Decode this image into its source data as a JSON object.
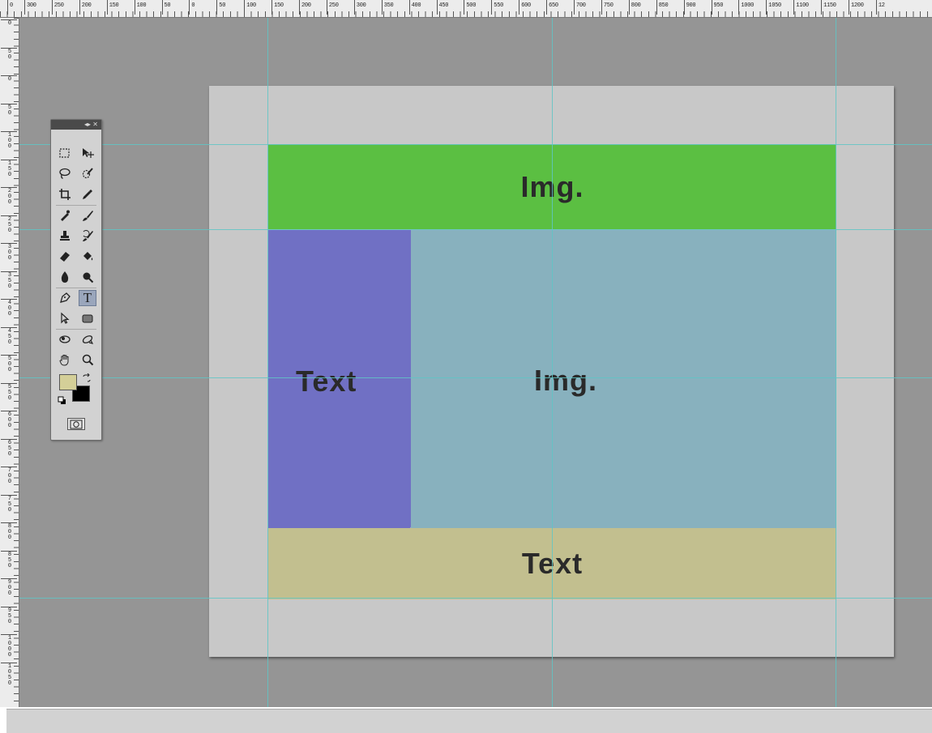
{
  "ruler_top": {
    "labels": [
      "0",
      "300",
      "250",
      "200",
      "150",
      "100",
      "50",
      "0",
      "50",
      "100",
      "150",
      "200",
      "250",
      "300",
      "350",
      "400",
      "450",
      "500",
      "550",
      "600",
      "650",
      "700",
      "750",
      "800",
      "850",
      "900",
      "950",
      "1000",
      "1050",
      "1100",
      "1150",
      "1200",
      "12"
    ]
  },
  "ruler_left": {
    "labels": [
      "0",
      "50",
      "0",
      "50",
      "100",
      "150",
      "200",
      "250",
      "300",
      "350",
      "400",
      "450",
      "500",
      "550",
      "600",
      "650",
      "700",
      "750",
      "800",
      "850",
      "900",
      "950",
      "1000",
      "1050"
    ]
  },
  "canvas": {
    "header_label": "Img.",
    "side_label": "Text",
    "main_label": "Img.",
    "footer_label": "Text"
  },
  "colors": {
    "workspace": "#959595",
    "artboard": "#c8c8c8",
    "header_block": "#5bbf42",
    "side_block": "#7070c4",
    "main_block": "#88b1be",
    "footer_block": "#c2bf8f",
    "guide": "#5fc6c6",
    "foreground": "#d4cf98",
    "background": "#000000"
  },
  "toolbox": {
    "header_glyphs": "◂▸ ✕",
    "tools": [
      [
        "marquee-icon",
        "move-icon"
      ],
      [
        "lasso-icon",
        "quick-selection-icon"
      ],
      [
        "crop-icon",
        "eyedropper-icon"
      ],
      [
        "spot-healing-icon",
        "brush-icon"
      ],
      [
        "clone-stamp-icon",
        "history-brush-icon"
      ],
      [
        "eraser-icon",
        "paint-bucket-icon"
      ],
      [
        "blur-icon",
        "dodge-icon"
      ],
      [
        "pen-icon",
        "type-icon"
      ],
      [
        "path-selection-icon",
        "rectangle-shape-icon"
      ],
      [
        "3d-rotate-icon",
        "3d-orbit-icon"
      ],
      [
        "hand-icon",
        "zoom-icon"
      ]
    ],
    "active_tool": "type-icon",
    "type_tool_glyph": "T"
  }
}
